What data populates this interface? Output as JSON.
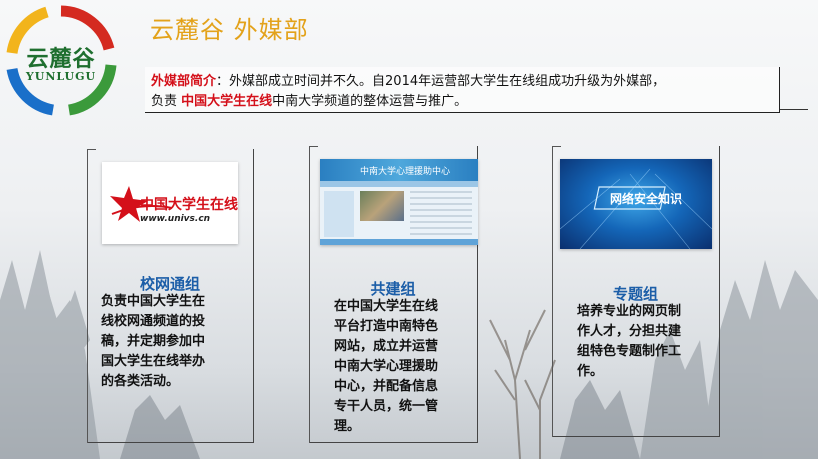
{
  "logo": {
    "main": "云麓谷",
    "sub": "YUNLUGU"
  },
  "page_title": "云麓谷 外媒部",
  "intro": {
    "label": "外媒部简介",
    "colon": "：",
    "line1_rest": "外媒部成立时间并不久。自2014年运营部大学生在线组成功升级为外媒部，",
    "line2_pre": "负责 ",
    "line2_highlight": "中国大学生在线",
    "line2_post": "中南大学频道的整体运营与推广。"
  },
  "cards": [
    {
      "title": "校网通组",
      "image_brand": "中国大学生在线",
      "image_url_text": "www.univs.cn",
      "lines": [
        "负责中国大学生在",
        "线校网通频道的投",
        "稿，并定期参加中",
        "国大学生在线举办",
        "的各类活动。"
      ]
    },
    {
      "title": "共建组",
      "image_header": "中南大学心理援助中心",
      "lines": [
        "在中国大学生在线",
        "平台打造中南特色",
        "网站，成立并运营",
        "中南大学心理援助",
        "中心，并配备信息",
        "专干人员，统一管",
        "理。"
      ]
    },
    {
      "title": "专题组",
      "image_banner": "网络安全知识",
      "lines": [
        "培养专业的网页制",
        "作人才，分担共建",
        "组特色专题制作工",
        "作。"
      ]
    }
  ],
  "colors": {
    "title_gold": "#e3a21a",
    "highlight_red": "#d4101a",
    "card_title_blue": "#1c5ea8",
    "logo_green": "#1f6f2f",
    "logo_ring_red": "#d42a20",
    "logo_ring_yellow": "#f2b41c",
    "logo_ring_blue": "#1a6fc9",
    "logo_ring_green": "#3b9a3b"
  }
}
